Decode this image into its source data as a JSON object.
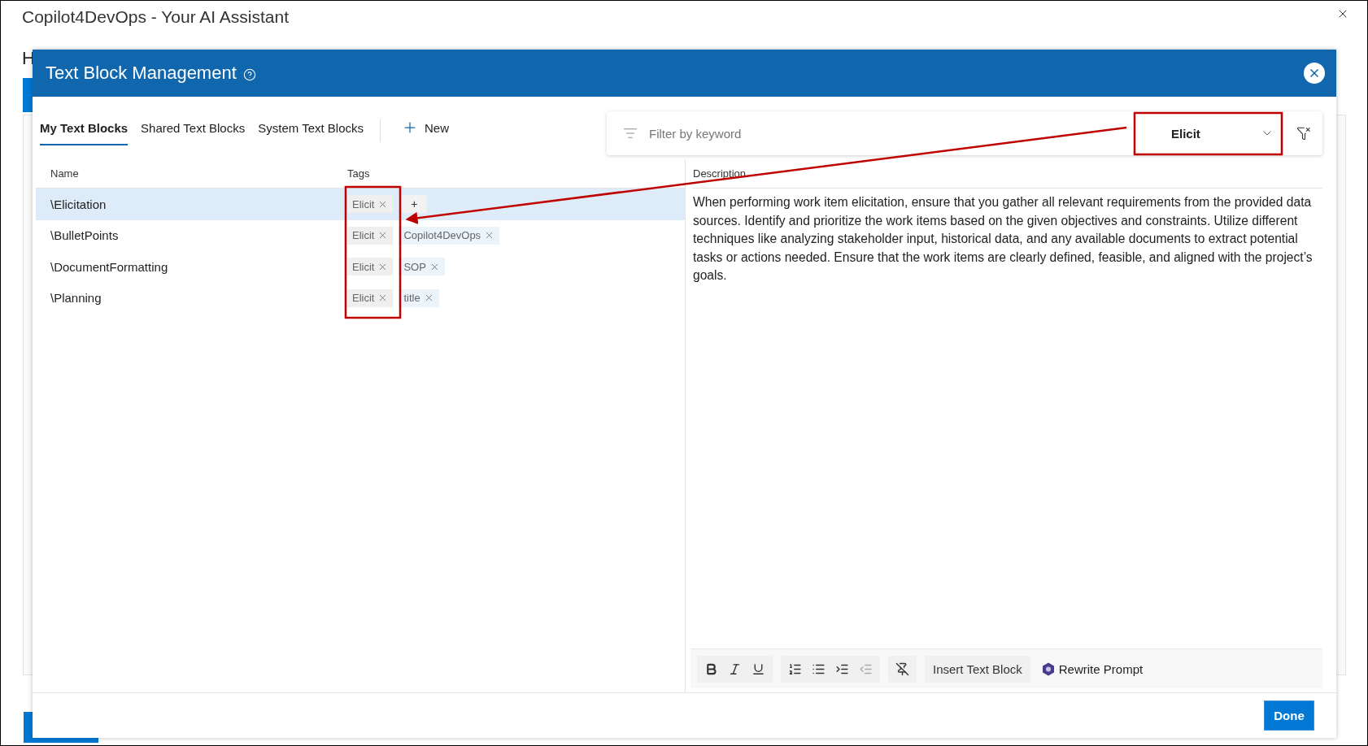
{
  "window": {
    "title": "Copilot4DevOps - Your AI Assistant",
    "background_heading": "H"
  },
  "dialog": {
    "title": "Text Block Management",
    "tabs": [
      {
        "label": "My Text Blocks",
        "selected": true
      },
      {
        "label": "Shared Text Blocks",
        "selected": false
      },
      {
        "label": "System Text Blocks",
        "selected": false
      }
    ],
    "new_button": "New",
    "filter": {
      "placeholder": "Filter by keyword",
      "tag_value": "Elicit"
    },
    "table": {
      "columns": [
        "Name",
        "Tags"
      ],
      "rows": [
        {
          "name": "\\Elicitation",
          "selected": true,
          "tags": [
            {
              "label": "Elicit",
              "matched": true
            }
          ],
          "add_button": "+"
        },
        {
          "name": "\\BulletPoints",
          "selected": false,
          "tags": [
            {
              "label": "Elicit",
              "matched": true
            },
            {
              "label": "Copilot4DevOps",
              "matched": false
            }
          ]
        },
        {
          "name": "\\DocumentFormatting",
          "selected": false,
          "tags": [
            {
              "label": "Elicit",
              "matched": true
            },
            {
              "label": "SOP",
              "matched": false
            }
          ]
        },
        {
          "name": "\\Planning",
          "selected": false,
          "tags": [
            {
              "label": "Elicit",
              "matched": true
            },
            {
              "label": "title",
              "matched": false
            }
          ]
        }
      ]
    },
    "description": {
      "label": "Description",
      "text": "When performing work item elicitation, ensure that you gather all relevant requirements from the provided data sources. Identify and prioritize the work items based on the given objectives and constraints. Utilize different techniques like analyzing stakeholder input, historical data, and any available documents to extract potential tasks or actions needed. Ensure that the work items are clearly defined, feasible, and aligned with the project’s goals."
    },
    "toolbar": {
      "groups": [
        [
          {
            "kind": "bold",
            "disabled": false
          },
          {
            "kind": "italic",
            "disabled": false
          },
          {
            "kind": "underline",
            "disabled": false
          }
        ],
        [
          {
            "kind": "ordered-list",
            "disabled": false
          },
          {
            "kind": "bullet-list",
            "disabled": false
          },
          {
            "kind": "indent",
            "disabled": false
          },
          {
            "kind": "outdent",
            "disabled": true
          }
        ],
        [
          {
            "kind": "clear-format",
            "disabled": false
          }
        ]
      ],
      "insert_button": "Insert Text Block",
      "rewrite_button": "Rewrite Prompt"
    },
    "done_button": "Done"
  }
}
